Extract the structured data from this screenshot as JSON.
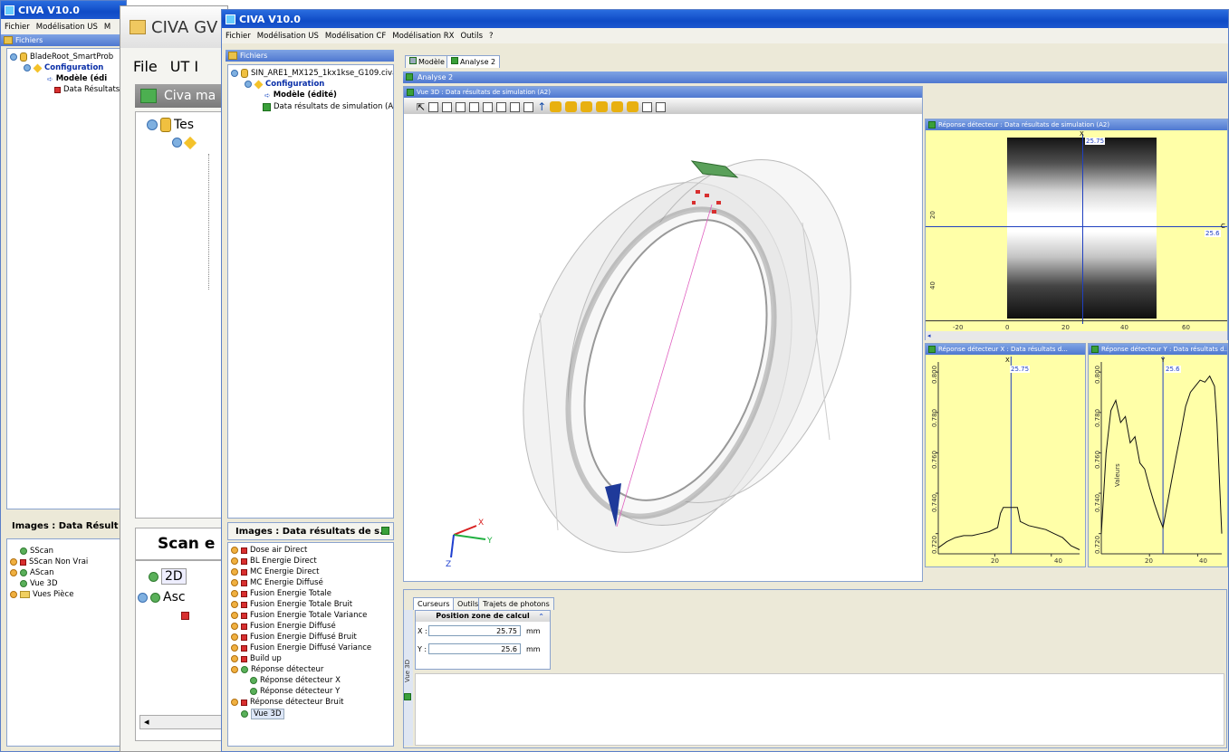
{
  "app_title": "CIVA V10.0",
  "back_window": {
    "menu": [
      "Fichier",
      "Modélisation US",
      "M"
    ],
    "files_header": "Fichiers",
    "tree": [
      "BladeRoot_SmartProb",
      "Configuration",
      "Modèle (édi",
      "Data Résultats"
    ],
    "images_header": "Images : Data Résult",
    "images": [
      "SScan",
      "SScan Non Vrai",
      "AScan",
      "Vue 3D",
      "Vues Pièce"
    ]
  },
  "gw_window": {
    "title": "CIVA GV",
    "menu": [
      "File",
      "UT I"
    ],
    "panel_header": "Civa ma",
    "tree_item": "Tes",
    "scan_header": "Scan e",
    "list": [
      "2D",
      "Asc"
    ]
  },
  "front_window": {
    "menu": [
      "Fichier",
      "Modélisation US",
      "Modélisation CF",
      "Modélisation RX",
      "Outils",
      "?"
    ],
    "files_header": "Fichiers",
    "tree": {
      "root": "SIN_ARE1_MX125_1kx1kse_G109.civa",
      "config": "Configuration",
      "model": "Modèle (édité)",
      "data": "Data résultats de simulation (A2)"
    },
    "images_header": "Images : Data résultats de s...",
    "images": [
      "Dose air Direct",
      "BL Energie Direct",
      "MC Energie Direct",
      "MC Energie Diffusé",
      "Fusion Energie Totale",
      "Fusion Energie Totale Bruit",
      "Fusion Energie Totale Variance",
      "Fusion Energie Diffusé",
      "Fusion Energie Diffusé Bruit",
      "Fusion Energie Diffusé Variance",
      "Build up",
      "Réponse détecteur",
      "Réponse détecteur X",
      "Réponse détecteur Y",
      "Réponse détecteur Bruit",
      "Vue 3D"
    ],
    "tabs": [
      "Modèle",
      "Analyse 2"
    ],
    "analysis_header": "Analyse 2",
    "view3d_header": "Vue 3D : Data résultats de simulation (A2)",
    "axes": {
      "x": "X",
      "y": "Y",
      "z": "Z"
    },
    "detector_header": "Réponse détecteur : Data résultats de simulation (A2)",
    "detx_header": "Réponse détecteur X : Data résultats d...",
    "dety_header": "Réponse détecteur Y : Data résultats d...",
    "bottom_tabs": [
      "Curseurs",
      "Outils",
      "Trajets de photons"
    ],
    "position_title": "Position zone de calcul",
    "x_label": "X :",
    "x_value": "25.75",
    "y_label": "Y :",
    "y_value": "25.6",
    "unit": "mm",
    "side_label": "Vue 3D",
    "cursor_x": "25.75",
    "cursor_y": "25.6",
    "cursor_label_x": "X",
    "cursor_label_y": "Y",
    "c_label": "C",
    "values_label": "Valeurs",
    "detector_xticks": [
      "-20",
      "0",
      "20",
      "40",
      "60"
    ],
    "detector_yticks": [
      "20",
      "40"
    ],
    "detx_xticks": [
      "20",
      "40"
    ],
    "detx_yticks": [
      "0.800",
      "0.780",
      "0.760",
      "0.740",
      "0.720"
    ],
    "dety_xticks": [
      "20",
      "40"
    ],
    "dety_yticks": [
      "0.800",
      "0.780",
      "0.760",
      "0.740",
      "0.720"
    ]
  },
  "chart_data": [
    {
      "type": "line",
      "x": [
        0,
        3,
        6,
        9,
        12,
        15,
        18,
        21,
        22,
        23,
        24,
        25.75,
        27,
        28,
        29,
        32,
        35,
        38,
        41,
        44,
        47,
        50
      ],
      "values": [
        0.713,
        0.716,
        0.718,
        0.719,
        0.719,
        0.72,
        0.721,
        0.723,
        0.73,
        0.733,
        0.733,
        0.733,
        0.733,
        0.733,
        0.726,
        0.724,
        0.723,
        0.722,
        0.72,
        0.718,
        0.714,
        0.712
      ],
      "xlim": [
        0,
        50
      ],
      "ylim": [
        0.71,
        0.805
      ],
      "xticks": [
        20,
        40
      ],
      "yticks": [
        0.8,
        0.78,
        0.76,
        0.74,
        0.72
      ],
      "cursor_x": 25.75
    },
    {
      "type": "line",
      "x": [
        0,
        2,
        4,
        6,
        8,
        10,
        12,
        14,
        16,
        18,
        20,
        22,
        24,
        25.6,
        27,
        29,
        31,
        33,
        35,
        37,
        39,
        41,
        43,
        45,
        47,
        48,
        50
      ],
      "values": [
        0.72,
        0.76,
        0.781,
        0.786,
        0.775,
        0.778,
        0.765,
        0.768,
        0.755,
        0.752,
        0.743,
        0.735,
        0.728,
        0.723,
        0.732,
        0.745,
        0.758,
        0.77,
        0.783,
        0.79,
        0.793,
        0.796,
        0.795,
        0.798,
        0.793,
        0.775,
        0.72
      ],
      "xlim": [
        0,
        50
      ],
      "ylim": [
        0.71,
        0.805
      ],
      "xticks": [
        20,
        40
      ],
      "yticks": [
        0.8,
        0.78,
        0.76,
        0.74,
        0.72
      ],
      "cursor_x": 25.6
    }
  ]
}
